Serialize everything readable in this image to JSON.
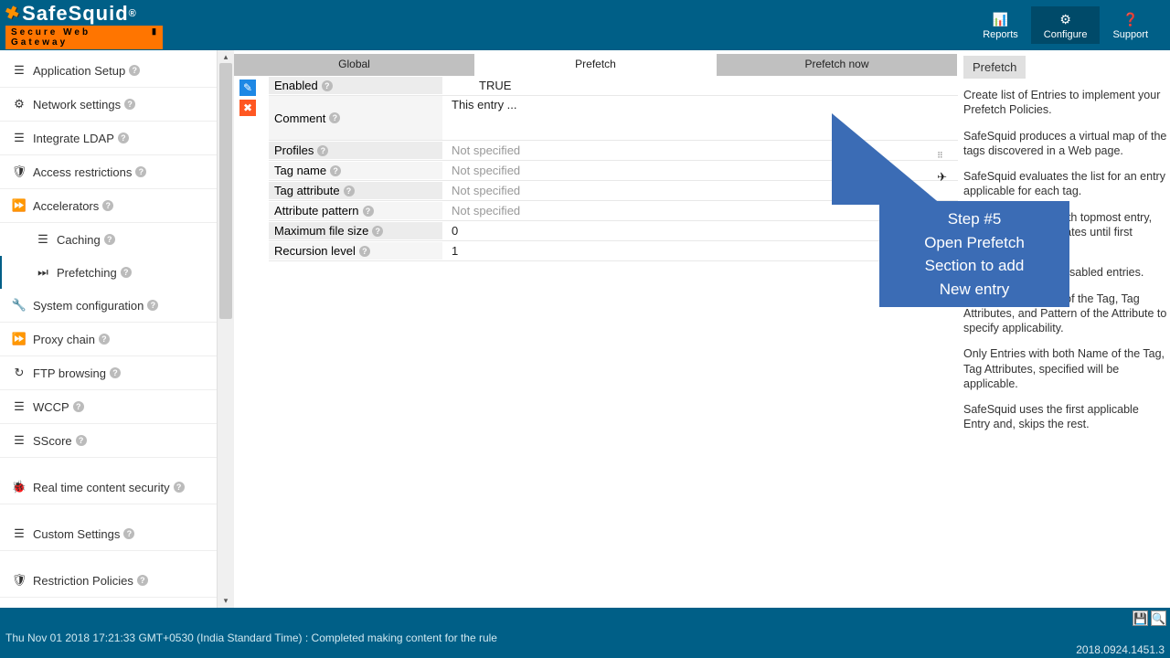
{
  "header": {
    "logo_main": "SafeSquid",
    "logo_reg": "®",
    "logo_sub": "Secure Web Gateway",
    "nav": {
      "reports": "Reports",
      "configure": "Configure",
      "support": "Support"
    }
  },
  "sidebar": {
    "app_setup": "Application Setup",
    "network": "Network settings",
    "ldap": "Integrate LDAP",
    "access": "Access restrictions",
    "accel": "Accelerators",
    "caching": "Caching",
    "prefetch": "Prefetching",
    "sysconf": "System configuration",
    "proxy": "Proxy chain",
    "ftp": "FTP browsing",
    "wccp": "WCCP",
    "sscore": "SScore",
    "realtime": "Real time content security",
    "custom": "Custom Settings",
    "restrict": "Restriction Policies"
  },
  "tabs": {
    "global": "Global",
    "prefetch": "Prefetch",
    "now": "Prefetch now"
  },
  "form": {
    "enabled": {
      "label": "Enabled",
      "value": "TRUE"
    },
    "comment": {
      "label": "Comment",
      "value": "This entry ..."
    },
    "profiles": {
      "label": "Profiles",
      "value": "Not specified"
    },
    "tagname": {
      "label": "Tag name",
      "value": "Not specified"
    },
    "tagattr": {
      "label": "Tag attribute",
      "value": "Not specified"
    },
    "attrpat": {
      "label": "Attribute pattern",
      "value": "Not specified"
    },
    "maxfile": {
      "label": "Maximum file size",
      "value": "0"
    },
    "recur": {
      "label": "Recursion level",
      "value": "1"
    }
  },
  "callout": {
    "line1": "Step #5",
    "line2": "Open Prefetch",
    "line3": "Section to add",
    "line4": "New entry"
  },
  "right": {
    "title": "Prefetch",
    "p1": "Create list of Entries to implement your Prefetch Policies.",
    "p2": "SafeSquid produces a virtual map of the tags discovered in a Web page.",
    "p3": "SafeSquid evaluates the list for an entry applicable for each tag.",
    "p4": "Evaluation begins with topmost entry, and sequentially iterates until first applicability match.",
    "p5": "Evaluation ignores disabled entries.",
    "p6": "Use Profiles, Name of the Tag, Tag Attributes, and Pattern of the Attribute to specify applicability.",
    "p7": "Only Entries with both Name of the Tag, Tag Attributes, specified will be applicable.",
    "p8": "SafeSquid uses the first applicable Entry and, skips the rest."
  },
  "footer": {
    "status": "Thu Nov 01 2018 17:21:33 GMT+0530 (India Standard Time) : Completed making content for the rule",
    "version": "2018.0924.1451.3"
  }
}
